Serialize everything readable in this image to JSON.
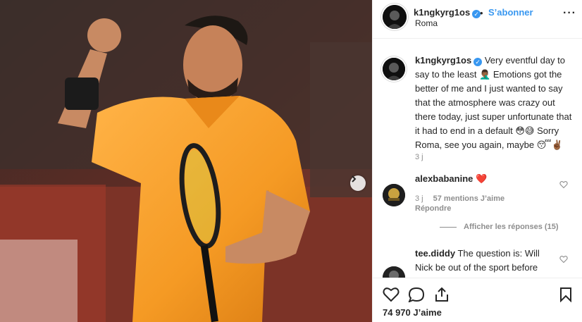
{
  "post": {
    "author": "k1ngkyrg1os",
    "verified_mark": "✓",
    "follow_label": "S’abonner",
    "separator": "•",
    "location": "Roma",
    "more_label": "···",
    "next_icon": "chevron-right-icon"
  },
  "caption": {
    "username": "k1ngkyrg1os",
    "text": "Very eventful day to say to the least 🤦🏾‍♂️ Emotions got the better of me and I just wanted to say that the atmosphere was crazy out there today, just super unfortunate that it had to end in a default 😳😅 Sorry Roma, see you again, maybe 😴✌🏾",
    "time": "3 j"
  },
  "comments": [
    {
      "username": "alexbabanine",
      "text": "❤️",
      "time": "3 j",
      "likes": "57 mentions J’aime",
      "reply_label": "Répondre",
      "view_replies": "Afficher les réponses (15)"
    },
    {
      "username": "tee.diddy",
      "text": "The question is: Will Nick be out of the sport before Federer retires?"
    }
  ],
  "actions": {
    "like_icon": "heart-outline-icon",
    "comment_icon": "comment-bubble-icon",
    "share_icon": "share-upload-icon",
    "save_icon": "bookmark-icon",
    "likes_count": "74 970 J’aime"
  },
  "colors": {
    "accent": "#3897f0",
    "muted": "#8e8e8e",
    "text": "#262626",
    "border": "#efefef",
    "heart": "#ed4956"
  }
}
